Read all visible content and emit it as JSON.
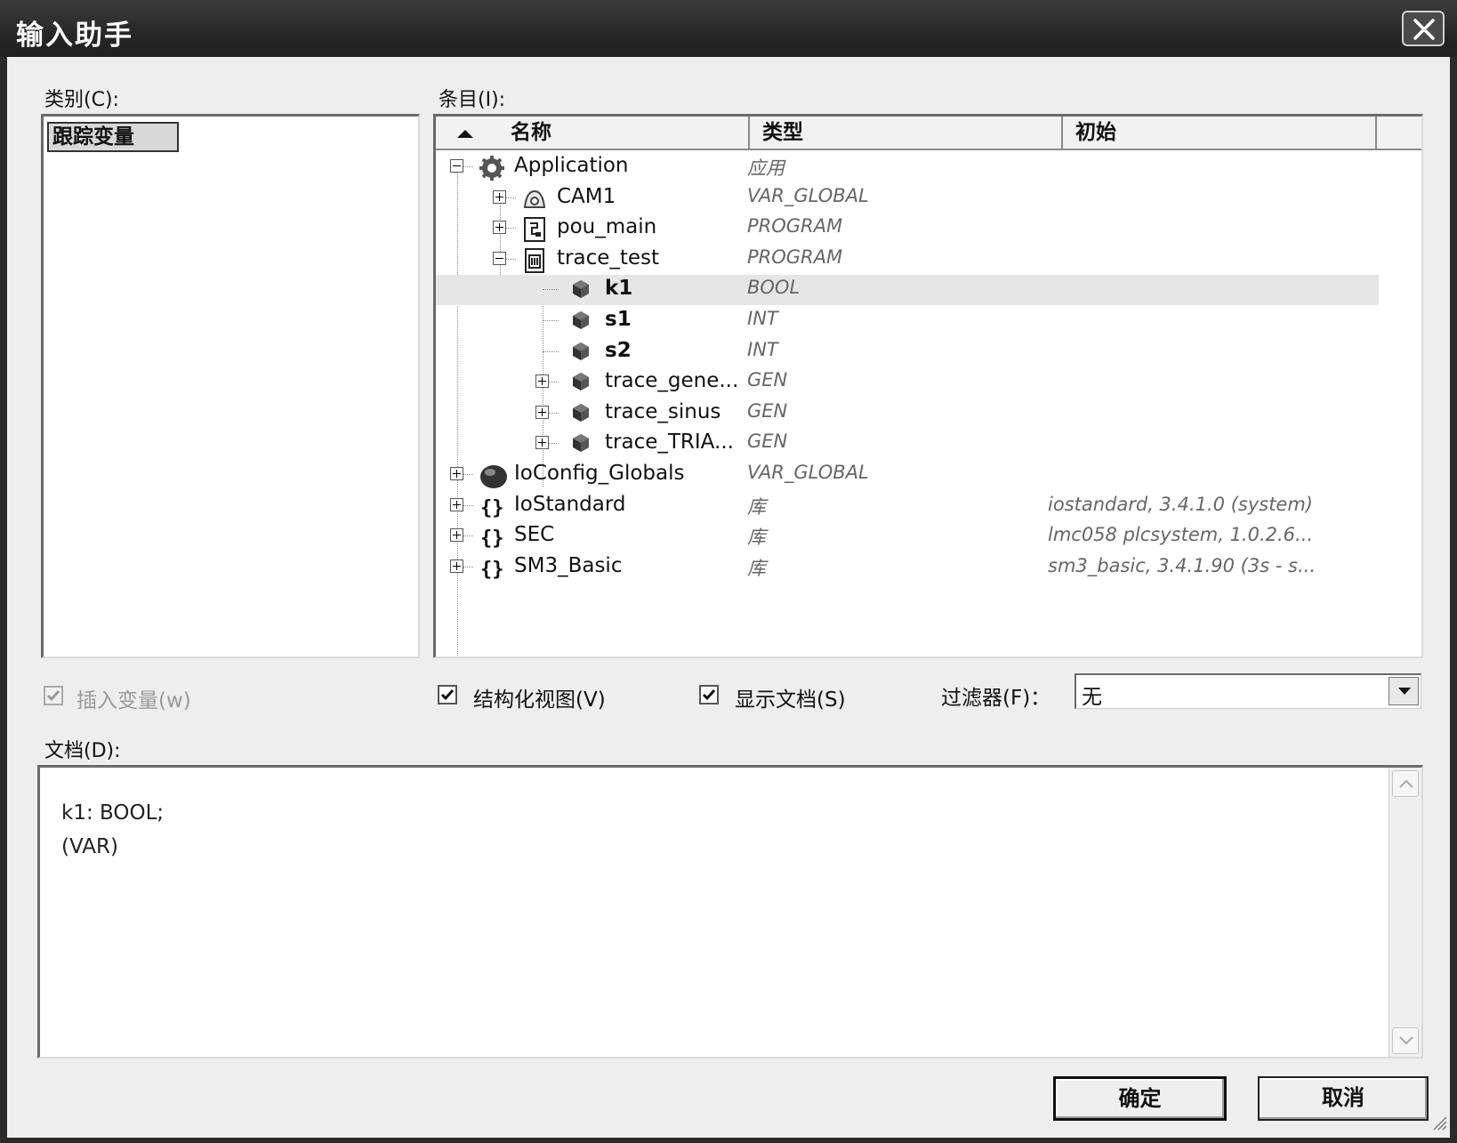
{
  "window": {
    "title": "输入助手",
    "close_icon": "close-icon"
  },
  "category": {
    "label": "类别(C):",
    "items": [
      "跟踪变量"
    ],
    "selected": "跟踪变量"
  },
  "entries": {
    "label": "条目(I):",
    "columns": [
      "名称",
      "类型",
      "初始"
    ],
    "sort_icon": "sort-ascending-icon",
    "rows": [
      {
        "name": "Application",
        "type": "应用",
        "init": "",
        "level": 0,
        "expander": "minus",
        "icon": "application-gear-icon"
      },
      {
        "name": "CAM1",
        "type": "VAR_GLOBAL",
        "init": "",
        "level": 1,
        "expander": "plus",
        "icon": "cam-icon"
      },
      {
        "name": "pou_main",
        "type": "PROGRAM",
        "init": "",
        "level": 1,
        "expander": "plus",
        "icon": "program-icon"
      },
      {
        "name": "trace_test",
        "type": "PROGRAM",
        "init": "",
        "level": 1,
        "expander": "minus",
        "icon": "program-doc-icon"
      },
      {
        "name": "k1",
        "type": "BOOL",
        "init": "",
        "level": 2,
        "expander": "",
        "icon": "variable-icon",
        "bold": true,
        "selected": true
      },
      {
        "name": "s1",
        "type": "INT",
        "init": "",
        "level": 2,
        "expander": "",
        "icon": "variable-icon",
        "bold": true
      },
      {
        "name": "s2",
        "type": "INT",
        "init": "",
        "level": 2,
        "expander": "",
        "icon": "variable-icon",
        "bold": true
      },
      {
        "name": "trace_gene...",
        "type": "GEN",
        "init": "",
        "level": 2,
        "expander": "plus",
        "icon": "variable-icon"
      },
      {
        "name": "trace_sinus",
        "type": "GEN",
        "init": "",
        "level": 2,
        "expander": "plus",
        "icon": "variable-icon"
      },
      {
        "name": "trace_TRIA...",
        "type": "GEN",
        "init": "",
        "level": 2,
        "expander": "plus",
        "icon": "variable-icon"
      },
      {
        "name": "IoConfig_Globals",
        "type": "VAR_GLOBAL",
        "init": "",
        "level": 0,
        "expander": "plus",
        "icon": "globe-icon"
      },
      {
        "name": "IoStandard",
        "type": "库",
        "init": "iostandard, 3.4.1.0 (system)",
        "level": 0,
        "expander": "plus",
        "icon": "library-braces-icon"
      },
      {
        "name": "SEC",
        "type": "库",
        "init": "lmc058 plcsystem, 1.0.2.6...",
        "level": 0,
        "expander": "plus",
        "icon": "library-braces-icon"
      },
      {
        "name": "SM3_Basic",
        "type": "库",
        "init": "sm3_basic, 3.4.1.90 (3s - s...",
        "level": 0,
        "expander": "plus",
        "icon": "library-braces-icon"
      }
    ]
  },
  "options": {
    "insert_variable": {
      "label": "插入变量(w)",
      "checked": true,
      "disabled": true
    },
    "structured_view": {
      "label": "结构化视图(V)",
      "checked": true
    },
    "show_docs": {
      "label": "显示文档(S)",
      "checked": true
    },
    "filter_label": "过滤器(F)：",
    "filter_value": "无"
  },
  "documentation": {
    "label": "文档(D):",
    "text": "k1: BOOL;\n(VAR)"
  },
  "buttons": {
    "ok": "确定",
    "cancel": "取消"
  }
}
